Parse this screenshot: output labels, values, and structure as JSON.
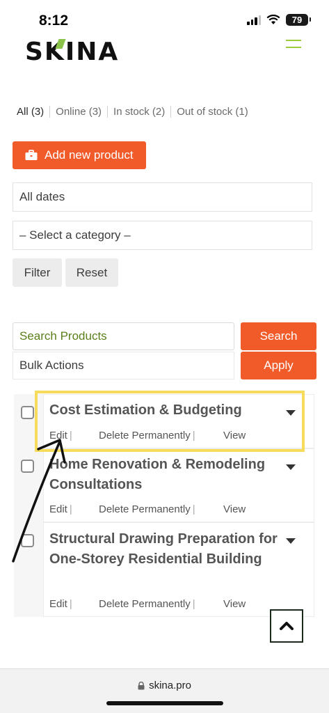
{
  "status_bar": {
    "time": "8:12",
    "battery": "79"
  },
  "header": {
    "logo": "SKINA"
  },
  "filters": [
    {
      "label": "All (3)"
    },
    {
      "label": "Online (3)"
    },
    {
      "label": "In stock (2)"
    },
    {
      "label": "Out of stock (1)"
    }
  ],
  "toolbar": {
    "add_label": "Add new product",
    "date_select": "All dates",
    "category_select": "– Select a category –",
    "filter_label": "Filter",
    "reset_label": "Reset",
    "search_placeholder": "Search Products",
    "search_label": "Search",
    "bulk_select": "Bulk Actions",
    "apply_label": "Apply"
  },
  "products": [
    {
      "title": "Cost Estimation & Budgeting",
      "edit": "Edit",
      "delete": "Delete Permanently",
      "view": "View"
    },
    {
      "title": "Home Renovation & Remodeling Consultations",
      "edit": "Edit",
      "delete": "Delete Permanently",
      "view": "View"
    },
    {
      "title": "Structural Drawing Preparation for One-Storey Residential Building",
      "edit": "Edit",
      "delete": "Delete Permanently",
      "view": "View"
    }
  ],
  "browser": {
    "url": "skina.pro"
  },
  "colors": {
    "accent": "#f15a29",
    "highlight": "#f6dc5a",
    "brand_green": "#9ccc3c"
  }
}
